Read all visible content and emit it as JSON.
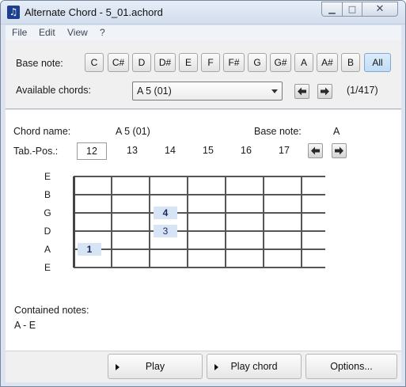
{
  "window": {
    "title": "Alternate Chord - 5_01.achord"
  },
  "menu": {
    "items": [
      "File",
      "Edit",
      "View",
      "?"
    ]
  },
  "base_note_row": {
    "label": "Base note:",
    "notes": [
      "C",
      "C#",
      "D",
      "D#",
      "E",
      "F",
      "F#",
      "G",
      "G#",
      "A",
      "A#",
      "B",
      "All"
    ],
    "selected": "All"
  },
  "chords_row": {
    "label": "Available chords:",
    "selected_chord": "A 5 (01)",
    "counter": "(1/417)"
  },
  "chord_info": {
    "name_label": "Chord name:",
    "name_value": "A 5 (01)",
    "base_label": "Base note:",
    "base_value": "A",
    "tab_label": "Tab.-Pos.:",
    "frets": [
      "12",
      "13",
      "14",
      "15",
      "16",
      "17"
    ],
    "selected_fret": "12"
  },
  "fretboard": {
    "strings": [
      "E",
      "B",
      "G",
      "D",
      "A",
      "E"
    ],
    "fingers": [
      {
        "string": "G",
        "fret_index": 3,
        "label": "4",
        "bold": true
      },
      {
        "string": "D",
        "fret_index": 3,
        "label": "3",
        "bold": false
      },
      {
        "string": "A",
        "fret_index": 1,
        "label": "1",
        "bold": true
      }
    ]
  },
  "contained_notes": {
    "label": "Contained notes:",
    "value": "A - E"
  },
  "buttons": {
    "play": "Play",
    "play_chord": "Play chord",
    "options": "Options..."
  },
  "colors": {
    "finger_fill": "#d6e4f5",
    "active_note_button": "#c0dcf5",
    "title_bar": "#dbe4f0"
  },
  "icons": {
    "app": "music-note-icon",
    "prev": "arrow-left-icon",
    "next": "arrow-right-icon",
    "play": "play-triangle-icon"
  }
}
